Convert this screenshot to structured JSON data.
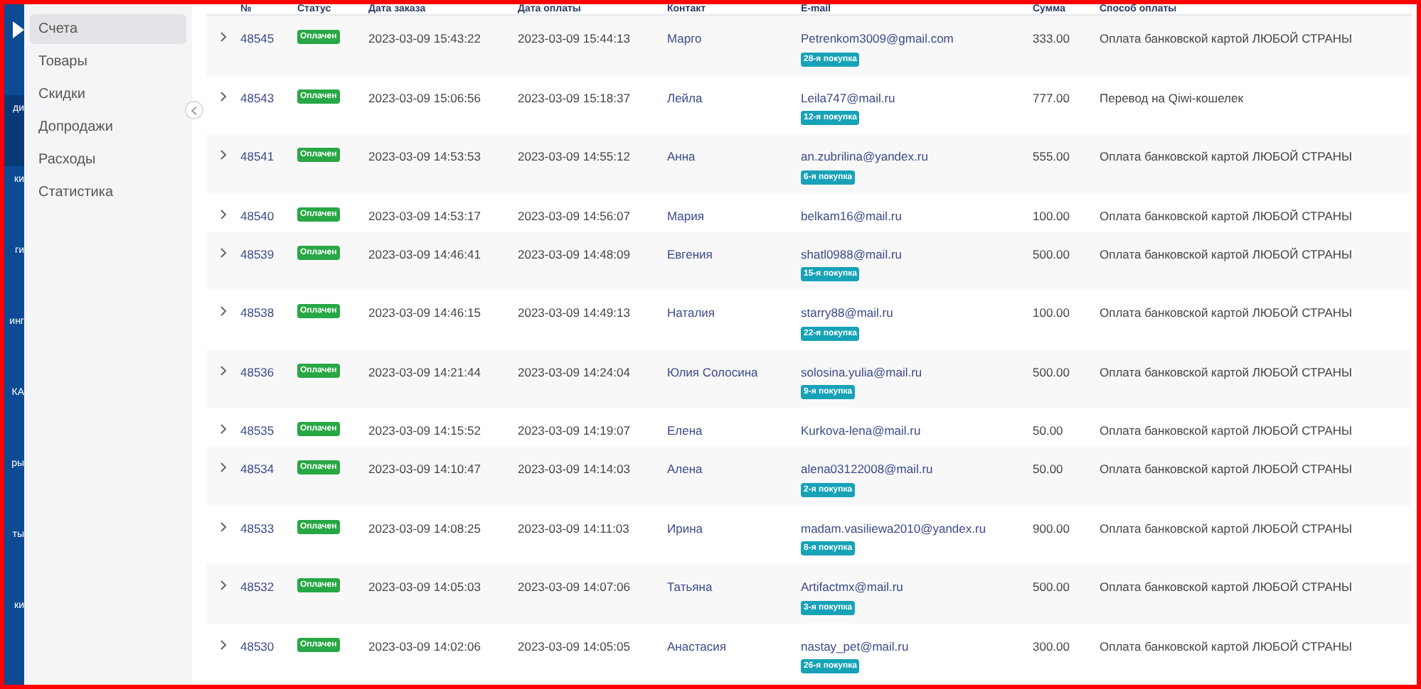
{
  "nav_rail": {
    "items": [
      {
        "label": "ди",
        "selected": true
      },
      {
        "label": "ки",
        "selected": false
      },
      {
        "label": "ги",
        "selected": false
      },
      {
        "label": "инг",
        "selected": false
      },
      {
        "label": "КА",
        "selected": false
      },
      {
        "label": "ры",
        "selected": false
      },
      {
        "label": "ты",
        "selected": false
      },
      {
        "label": "ки",
        "selected": false
      }
    ]
  },
  "sidebar": {
    "items": [
      {
        "label": "Счета",
        "selected": true
      },
      {
        "label": "Товары",
        "selected": false
      },
      {
        "label": "Скидки",
        "selected": false
      },
      {
        "label": "Допродажи",
        "selected": false
      },
      {
        "label": "Расходы",
        "selected": false
      },
      {
        "label": "Статистика",
        "selected": false
      }
    ]
  },
  "table": {
    "columns": [
      "№",
      "Статус",
      "Дата заказа",
      "Дата оплаты",
      "Контакт",
      "E-mail",
      "Сумма",
      "Способ оплаты"
    ],
    "rows": [
      {
        "id": "48545",
        "status": "Оплачен",
        "order_date": "2023-03-09 15:43:22",
        "pay_date": "2023-03-09 15:44:13",
        "contact": "Марго",
        "email": "Petrenkom3009@gmail.com",
        "purchase": "28-я покупка",
        "sum": "333.00",
        "method": "Оплата банковской картой ЛЮБОЙ СТРАНЫ"
      },
      {
        "id": "48543",
        "status": "Оплачен",
        "order_date": "2023-03-09 15:06:56",
        "pay_date": "2023-03-09 15:18:37",
        "contact": "Лейла",
        "email": "Leila747@mail.ru",
        "purchase": "12-я покупка",
        "sum": "777.00",
        "method": "Перевод на Qiwi-кошелек"
      },
      {
        "id": "48541",
        "status": "Оплачен",
        "order_date": "2023-03-09 14:53:53",
        "pay_date": "2023-03-09 14:55:12",
        "contact": "Анна",
        "email": "an.zubrilina@yandex.ru",
        "purchase": "6-я покупка",
        "sum": "555.00",
        "method": "Оплата банковской картой ЛЮБОЙ СТРАНЫ"
      },
      {
        "id": "48540",
        "status": "Оплачен",
        "order_date": "2023-03-09 14:53:17",
        "pay_date": "2023-03-09 14:56:07",
        "contact": "Мария",
        "email": "belkam16@mail.ru",
        "sum": "100.00",
        "method": "Оплата банковской картой ЛЮБОЙ СТРАНЫ"
      },
      {
        "id": "48539",
        "status": "Оплачен",
        "order_date": "2023-03-09 14:46:41",
        "pay_date": "2023-03-09 14:48:09",
        "contact": "Евгения",
        "email": "shatl0988@mail.ru",
        "purchase": "15-я покупка",
        "sum": "500.00",
        "method": "Оплата банковской картой ЛЮБОЙ СТРАНЫ"
      },
      {
        "id": "48538",
        "status": "Оплачен",
        "order_date": "2023-03-09 14:46:15",
        "pay_date": "2023-03-09 14:49:13",
        "contact": "Наталия",
        "email": "starry88@mail.ru",
        "purchase": "22-я покупка",
        "sum": "100.00",
        "method": "Оплата банковской картой ЛЮБОЙ СТРАНЫ"
      },
      {
        "id": "48536",
        "status": "Оплачен",
        "order_date": "2023-03-09 14:21:44",
        "pay_date": "2023-03-09 14:24:04",
        "contact": "Юлия Солосина",
        "email": "solosina.yulia@mail.ru",
        "purchase": "9-я покупка",
        "sum": "500.00",
        "method": "Оплата банковской картой ЛЮБОЙ СТРАНЫ"
      },
      {
        "id": "48535",
        "status": "Оплачен",
        "order_date": "2023-03-09 14:15:52",
        "pay_date": "2023-03-09 14:19:07",
        "contact": "Елена",
        "email": "Kurkova-lena@mail.ru",
        "sum": "50.00",
        "method": "Оплата банковской картой ЛЮБОЙ СТРАНЫ"
      },
      {
        "id": "48534",
        "status": "Оплачен",
        "order_date": "2023-03-09 14:10:47",
        "pay_date": "2023-03-09 14:14:03",
        "contact": "Алена",
        "email": "alena03122008@mail.ru",
        "purchase": "2-я покупка",
        "sum": "50.00",
        "method": "Оплата банковской картой ЛЮБОЙ СТРАНЫ"
      },
      {
        "id": "48533",
        "status": "Оплачен",
        "order_date": "2023-03-09 14:08:25",
        "pay_date": "2023-03-09 14:11:03",
        "contact": "Ирина",
        "email": "madam.vasiliewa2010@yandex.ru",
        "purchase": "8-я покупка",
        "sum": "900.00",
        "method": "Оплата банковской картой ЛЮБОЙ СТРАНЫ"
      },
      {
        "id": "48532",
        "status": "Оплачен",
        "order_date": "2023-03-09 14:05:03",
        "pay_date": "2023-03-09 14:07:06",
        "contact": "Татьяна",
        "email": "Artifactmx@mail.ru",
        "purchase": "3-я покупка",
        "sum": "500.00",
        "method": "Оплата банковской картой ЛЮБОЙ СТРАНЫ"
      },
      {
        "id": "48530",
        "status": "Оплачен",
        "order_date": "2023-03-09 14:02:06",
        "pay_date": "2023-03-09 14:05:05",
        "contact": "Анастасия",
        "email": "nastay_pet@mail.ru",
        "purchase": "26-я покупка",
        "sum": "300.00",
        "method": "Оплата банковской картой ЛЮБОЙ СТРАНЫ"
      }
    ]
  }
}
